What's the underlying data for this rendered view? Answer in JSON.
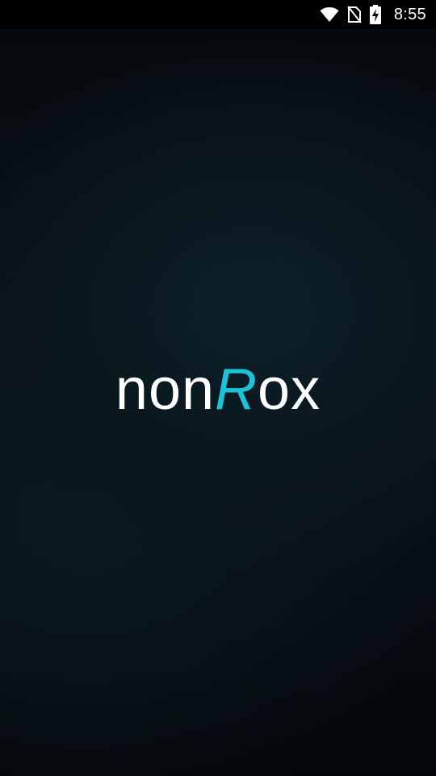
{
  "status_bar": {
    "time": "8:55",
    "icons": [
      "wifi-icon",
      "no-sim-icon",
      "battery-charging-icon"
    ]
  },
  "splash": {
    "logo_part1": "non",
    "logo_accent": "R",
    "logo_part2": "ox"
  },
  "colors": {
    "accent": "#19c4d8",
    "logo_text": "#ffffff",
    "background": "#070f14"
  }
}
